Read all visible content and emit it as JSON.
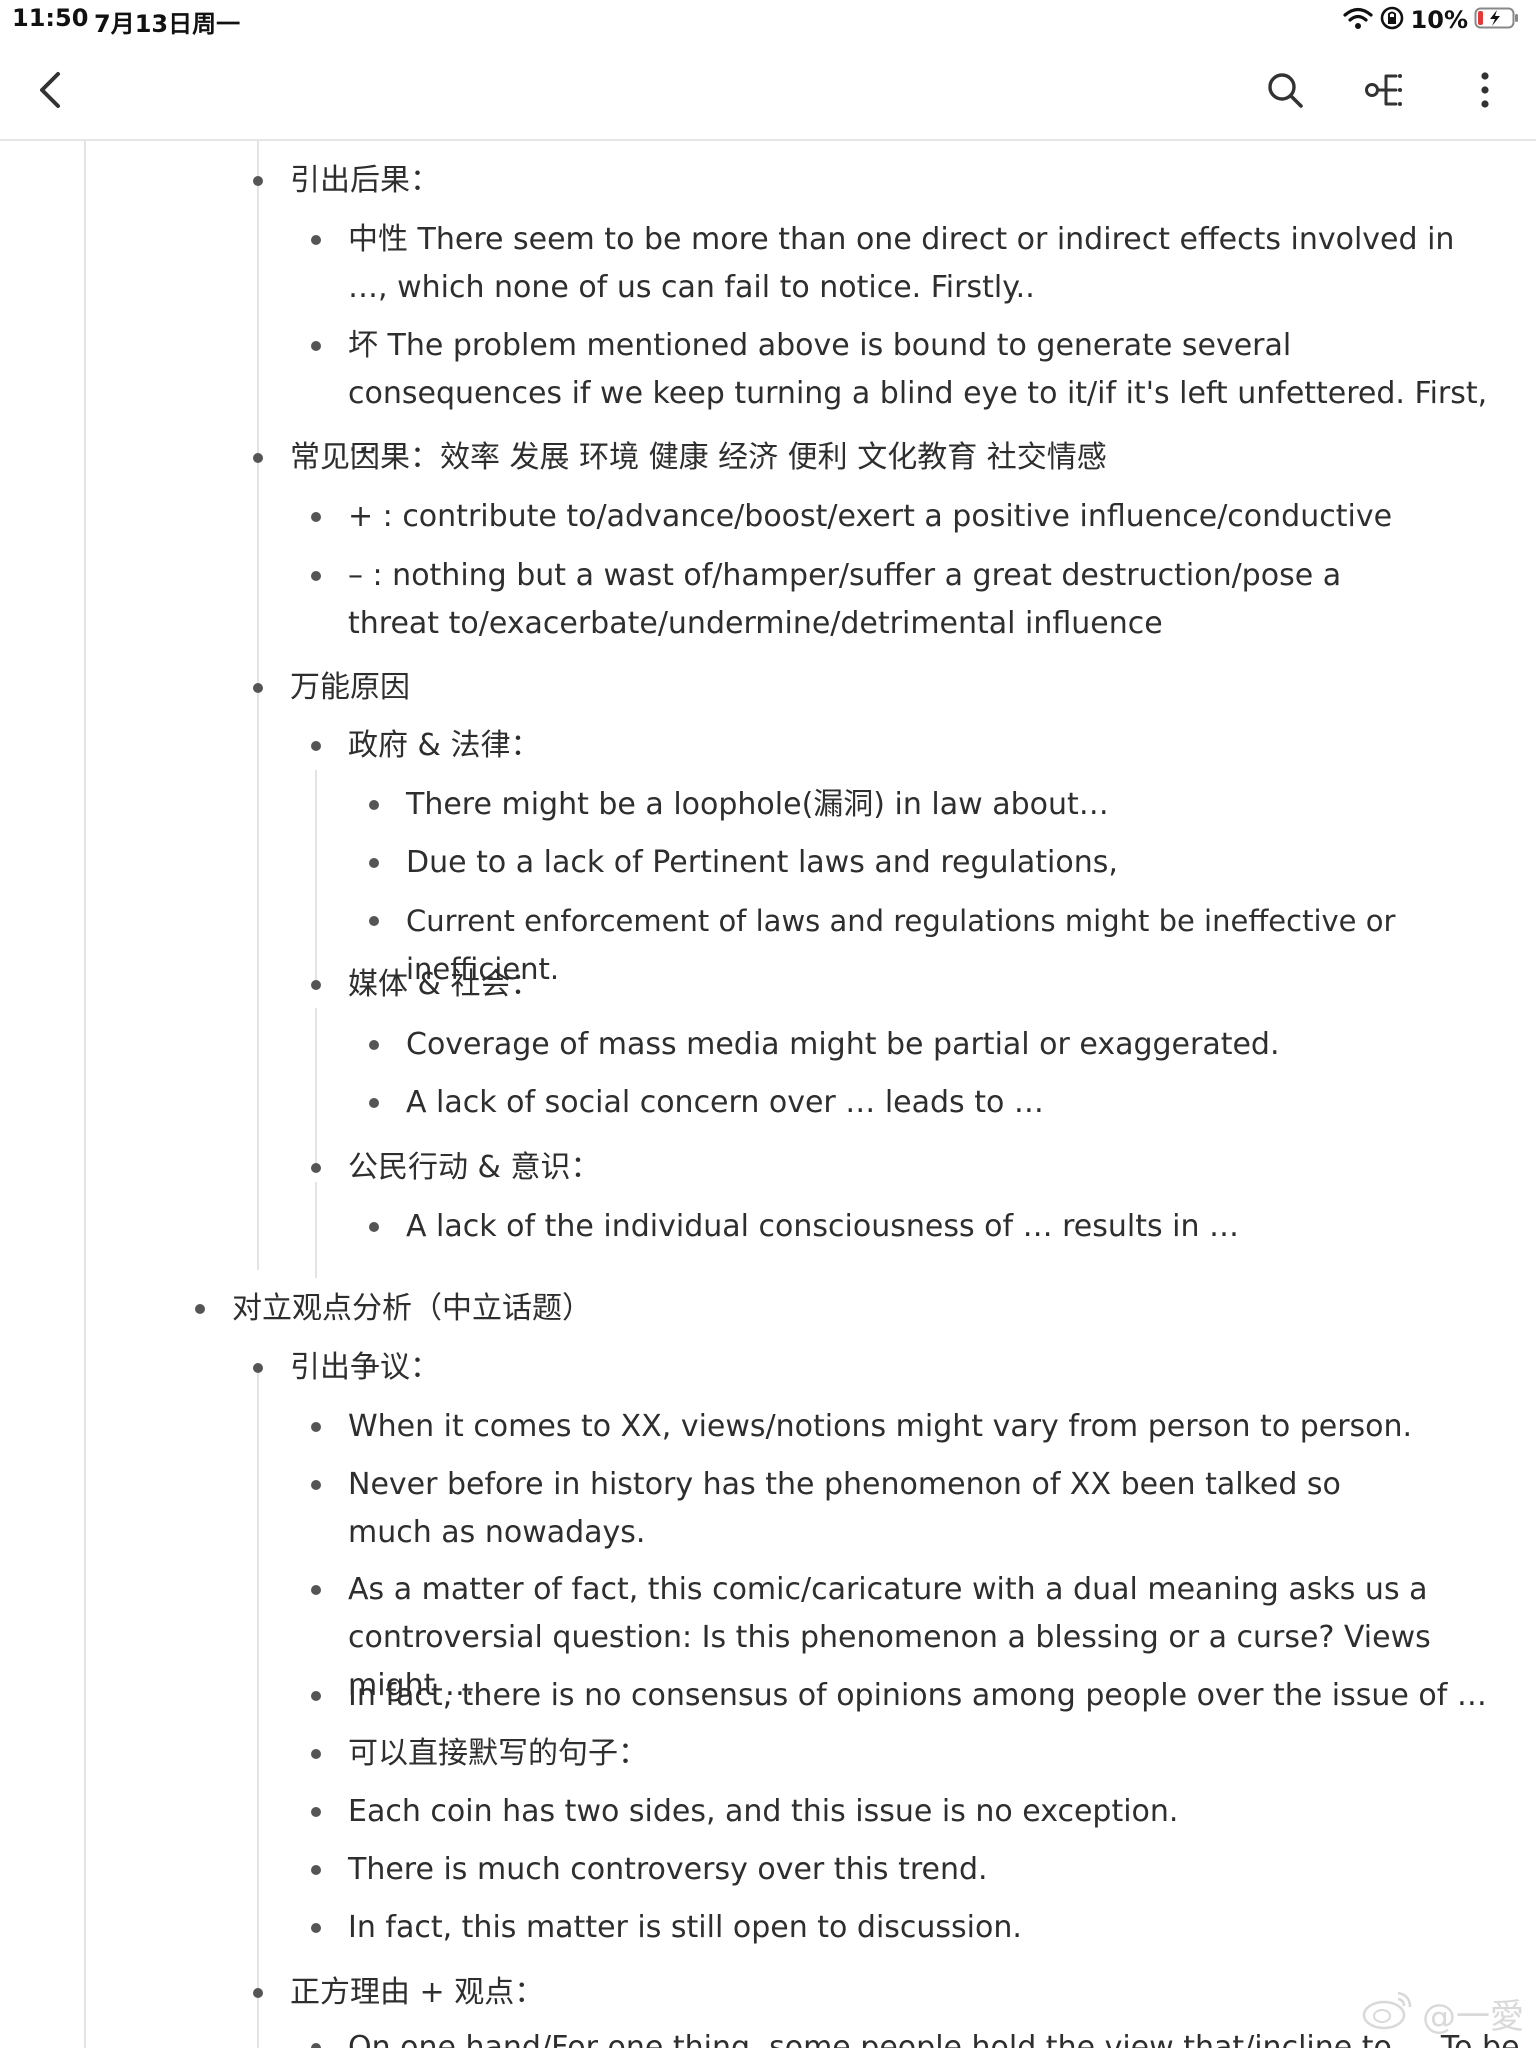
{
  "status_bar": {
    "time": "11:50",
    "date": "7月13日周一",
    "battery": "10%",
    "icons": [
      "wifi-icon",
      "orientation-lock-icon",
      "battery-charging-icon"
    ]
  },
  "toolbar": {
    "icons": [
      "back-icon",
      "search-icon",
      "mindmap-icon",
      "more-icon"
    ]
  },
  "outline": [
    {
      "level": 2,
      "text": "引出后果："
    },
    {
      "level": 3,
      "text": "中性 There seem to be more than one direct or indirect effects involved in …, which none of us can fail to notice. Firstly.."
    },
    {
      "level": 3,
      "text": "坏 The problem mentioned above is bound to generate several consequences if we keep turning a blind eye to it/if it's left unfettered. First, …"
    },
    {
      "level": 2,
      "text": "常见因果：效率 发展 环境 健康 经济 便利 文化教育 社交情感"
    },
    {
      "level": 3,
      "text": "+ : contribute to/advance/boost/exert a positive influence/conductive"
    },
    {
      "level": 3,
      "text": "– : nothing but a wast of/hamper/suffer a great destruction/pose a threat to/exacerbate/undermine/detrimental influence"
    },
    {
      "level": 2,
      "text": "万能原因"
    },
    {
      "level": 3,
      "text": "政府 & 法律："
    },
    {
      "level": 4,
      "text": "There might be a loophole(漏洞) in law about…"
    },
    {
      "level": 4,
      "text": "Due to a lack of Pertinent laws and regulations,"
    },
    {
      "level": 4,
      "text": "Current enforcement of laws and regulations might be ineffective or inefficient."
    },
    {
      "level": 3,
      "text": "媒体 & 社会："
    },
    {
      "level": 4,
      "text": "Coverage of mass media might be partial or exaggerated."
    },
    {
      "level": 4,
      "text": "A lack of social concern over … leads to …"
    },
    {
      "level": 3,
      "text": "公民行动 & 意识："
    },
    {
      "level": 4,
      "text": "A lack of the individual consciousness of … results in …"
    },
    {
      "level": 1,
      "text": "对立观点分析（中立话题）"
    },
    {
      "level": 2,
      "text": "引出争议："
    },
    {
      "level": 3,
      "text": "When it comes to XX, views/notions might vary from person to person."
    },
    {
      "level": 3,
      "text": "Never before in history has the phenomenon of XX been talked so much as nowadays."
    },
    {
      "level": 3,
      "text": "As a matter of fact, this comic/caricature with a dual meaning asks us a controversial question: Is this phenomenon a blessing or a curse? Views might …"
    },
    {
      "level": 3,
      "text": "In fact, there is no consensus of opinions among people over the issue of …"
    },
    {
      "level": 3,
      "text": "可以直接默写的句子："
    },
    {
      "level": 3,
      "text": "Each coin has two sides, and this issue is no exception."
    },
    {
      "level": 3,
      "text": "There is much controversy over this trend."
    },
    {
      "level": 3,
      "text": "In fact, this matter is still open to discussion."
    },
    {
      "level": 2,
      "text": "正方理由 + 观点："
    },
    {
      "level": 3,
      "text": "On one hand/For one thing, some people hold the view that/incline to … To be"
    }
  ],
  "watermark": {
    "text": "@一愛",
    "icon": "weibo-logo-icon"
  }
}
